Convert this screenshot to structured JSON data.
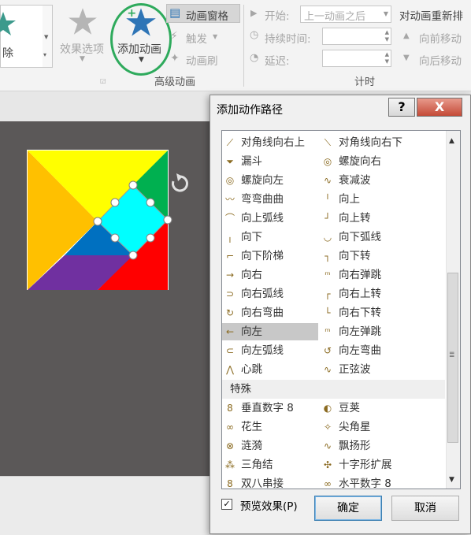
{
  "ribbon": {
    "left_button_label": "除",
    "effect_options_label": "效果选项",
    "add_animation_label": "添加动画",
    "animation_pane_label": "动画窗格",
    "trigger_label": "触发",
    "animation_painter_label": "动画刷",
    "advanced_group_label": "高级动画",
    "start_label": "开始:",
    "start_value": "上一动画之后",
    "duration_label": "持续时间:",
    "delay_label": "延迟:",
    "timing_group_label": "计时",
    "reorder_label": "对动画重新排",
    "move_earlier_label": "向前移动",
    "move_later_label": "向后移动"
  },
  "dialog": {
    "title": "添加动作路径",
    "help": "?",
    "close": "X",
    "items": [
      {
        "left": "对角线向右上",
        "left_icon": "diagonal-up-right-icon",
        "right": "对角线向右下",
        "right_icon": "diagonal-down-right-icon"
      },
      {
        "left": "漏斗",
        "left_icon": "funnel-icon",
        "right": "螺旋向右",
        "right_icon": "spiral-right-icon"
      },
      {
        "left": "螺旋向左",
        "left_icon": "spiral-left-icon",
        "right": "衰减波",
        "right_icon": "decaying-wave-icon"
      },
      {
        "left": "弯弯曲曲",
        "left_icon": "zigzag-icon",
        "right": "向上",
        "right_icon": "up-icon"
      },
      {
        "left": "向上弧线",
        "left_icon": "arc-up-icon",
        "right": "向上转",
        "right_icon": "turn-up-icon"
      },
      {
        "left": "向下",
        "left_icon": "down-icon",
        "right": "向下弧线",
        "right_icon": "arc-down-icon"
      },
      {
        "left": "向下阶梯",
        "left_icon": "stairs-down-icon",
        "right": "向下转",
        "right_icon": "turn-down-icon"
      },
      {
        "left": "向右",
        "left_icon": "right-icon",
        "right": "向右弹跳",
        "right_icon": "bounce-right-icon"
      },
      {
        "left": "向右弧线",
        "left_icon": "arc-right-icon",
        "right": "向右上转",
        "right_icon": "turn-up-right-icon"
      },
      {
        "left": "向右弯曲",
        "left_icon": "curvy-right-icon",
        "right": "向右下转",
        "right_icon": "turn-down-right-icon"
      },
      {
        "left": "向左",
        "left_icon": "left-icon",
        "right": "向左弹跳",
        "right_icon": "bounce-left-icon"
      },
      {
        "left": "向左弧线",
        "left_icon": "arc-left-icon",
        "right": "向左弯曲",
        "right_icon": "curvy-left-icon"
      },
      {
        "left": "心跳",
        "left_icon": "heartbeat-icon",
        "right": "正弦波",
        "right_icon": "sine-wave-icon"
      }
    ],
    "selected_item": "向左",
    "special_section_label": "特殊",
    "special_items": [
      {
        "left": "垂直数字 8",
        "left_icon": "vertical-figure8-icon",
        "right": "豆荚",
        "right_icon": "bean-icon"
      },
      {
        "left": "花生",
        "left_icon": "peanut-icon",
        "right": "尖角星",
        "right_icon": "pointy-star-icon"
      },
      {
        "left": "涟漪",
        "left_icon": "ripple-icon",
        "right": "飘扬形",
        "right_icon": "swoosh-icon"
      },
      {
        "left": "三角结",
        "left_icon": "trefoil-knot-icon",
        "right": "十字形扩展",
        "right_icon": "cross-expand-icon"
      },
      {
        "left": "双八串接",
        "left_icon": "double-eight-icon",
        "right": "水平数字 8",
        "right_icon": "horizontal-figure8-icon"
      }
    ],
    "preview_label": "预览效果(P)",
    "preview_checked": true,
    "ok_label": "确定",
    "cancel_label": "取消"
  },
  "colors": {
    "highlight_circle": "#2eaa5c",
    "star_blue": "#2e75b6",
    "canvas": "#5b5858",
    "tangram_yellow": "#ffff00",
    "tangram_orange": "#ffc000",
    "tangram_green": "#00b050",
    "tangram_blue": "#0070c0",
    "tangram_purple": "#7030a0",
    "tangram_red": "#ff0000",
    "tangram_cyan": "#00ffff"
  }
}
